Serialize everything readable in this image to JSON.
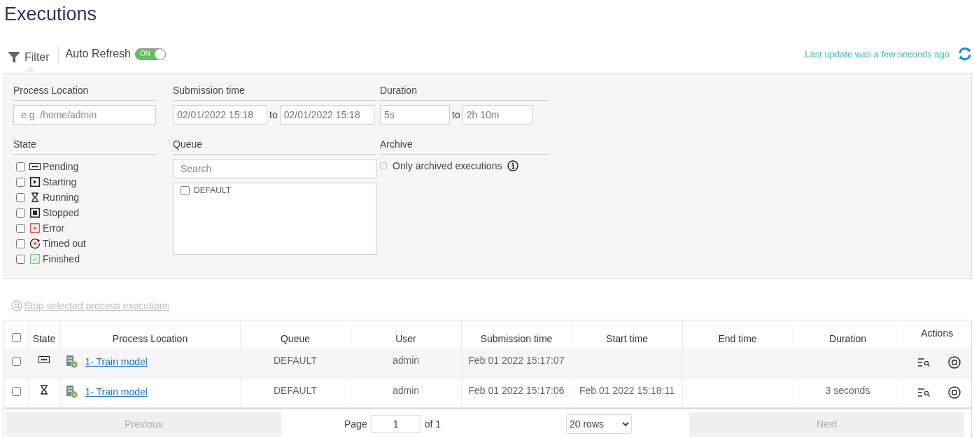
{
  "page_title": "Executions",
  "toolbar": {
    "filter_tab": {
      "label": "Filter",
      "selected": true
    },
    "auto_refresh": {
      "label": "Auto Refresh",
      "on": true,
      "toggle_text": "ON"
    },
    "last_update": "Last update was a few seconds ago"
  },
  "filter": {
    "process_location": {
      "label": "Process Location",
      "placeholder": "e.g. /home/admin"
    },
    "submission_time": {
      "label": "Submission time",
      "from": "02/01/2022 15:18",
      "separator": "to",
      "to": "02/01/2022 15:18"
    },
    "duration": {
      "label": "Duration",
      "from": "5s",
      "separator": "to",
      "to": "2h 10m"
    },
    "state": {
      "label": "State",
      "options": [
        {
          "kind": "pending",
          "label": "Pending",
          "checked": false
        },
        {
          "kind": "starting",
          "label": "Starting",
          "checked": false
        },
        {
          "kind": "running",
          "label": "Running",
          "checked": false
        },
        {
          "kind": "stopped",
          "label": "Stopped",
          "checked": false
        },
        {
          "kind": "error",
          "label": "Error",
          "checked": false
        },
        {
          "kind": "timed_out",
          "label": "Timed out",
          "checked": false
        },
        {
          "kind": "finished",
          "label": "Finished",
          "checked": false
        }
      ]
    },
    "queue": {
      "label": "Queue",
      "placeholder": "Search",
      "options": [
        {
          "label": "DEFAULT",
          "checked": false
        }
      ]
    },
    "archive": {
      "label": "Archive",
      "option": {
        "label": "Only archived executions",
        "checked": false
      }
    }
  },
  "stop_selected": {
    "label": "Stop selected process executions",
    "disabled": true
  },
  "table": {
    "select_all": {
      "checked": false
    },
    "columns": [
      "State",
      "Process Location",
      "Queue",
      "User",
      "Submission time",
      "Start time",
      "End time",
      "Duration",
      "Actions"
    ],
    "rows": [
      {
        "checked": false,
        "kind": "pending",
        "process_location": "1- Train model",
        "queue": "DEFAULT",
        "user": "admin",
        "submission_time": "Feb 01 2022 15:17:07",
        "start_time": "",
        "end_time": "",
        "duration": ""
      },
      {
        "checked": false,
        "kind": "running",
        "process_location": "1- Train model",
        "queue": "DEFAULT",
        "user": "admin",
        "submission_time": "Feb 01 2022 15:17:06",
        "start_time": "Feb 01 2022 15:18:11",
        "end_time": "",
        "duration": "3 seconds"
      }
    ]
  },
  "pagination": {
    "previous": {
      "label": "Previous",
      "disabled": true
    },
    "page_label": "Page",
    "page": "1",
    "of": "of 1",
    "rows_per_page": "20 rows",
    "next": {
      "label": "Next",
      "disabled": true
    }
  }
}
